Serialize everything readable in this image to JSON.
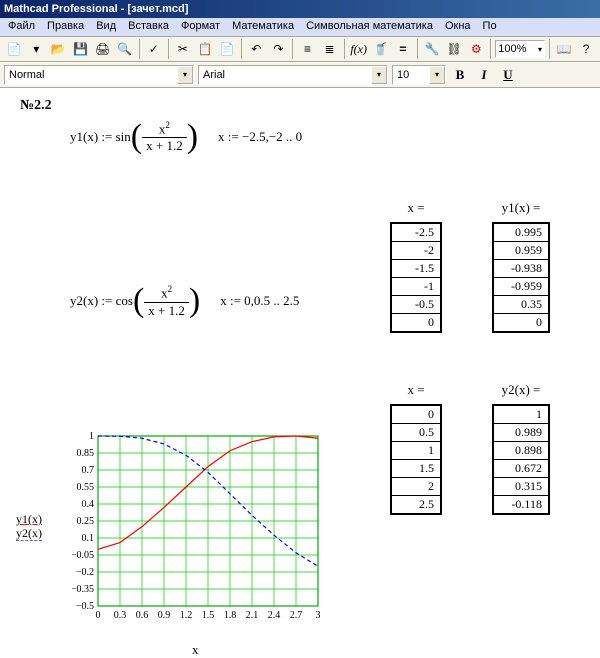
{
  "title": "Mathcad Professional - [зачет.mcd]",
  "menu": [
    "Файл",
    "Правка",
    "Вид",
    "Вставка",
    "Формат",
    "Математика",
    "Символьная математика",
    "Окна",
    "По"
  ],
  "zoom": "100%",
  "style": "Normal",
  "font": "Arial",
  "fontsize": "10",
  "section": "№2.2",
  "eq1": {
    "lhs": "y1(x)",
    "fn": "sin",
    "num": "x",
    "den": "x + 1.2",
    "range": "x := −2.5,−2 .. 0"
  },
  "eq2": {
    "lhs": "y2(x)",
    "fn": "cos",
    "num": "x",
    "den": "x + 1.2",
    "range": "x := 0,0.5 .. 2.5"
  },
  "t1hdr": "x =",
  "t1": [
    "-2.5",
    "-2",
    "-1.5",
    "-1",
    "-0.5",
    "0"
  ],
  "t2hdr": "y1(x) =",
  "t2": [
    "0.995",
    "0.959",
    "-0.938",
    "-0.959",
    "0.35",
    "0"
  ],
  "t3hdr": "x =",
  "t3": [
    "0",
    "0.5",
    "1",
    "1.5",
    "2",
    "2.5"
  ],
  "t4hdr": "y2(x) =",
  "t4": [
    "1",
    "0.989",
    "0.898",
    "0.672",
    "0.315",
    "-0.118"
  ],
  "ylabels": [
    "1",
    "0.85",
    "0.7",
    "0.55",
    "0.4",
    "0.25",
    "0.1",
    "−0.05",
    "−0.2",
    "−0.35",
    "−0.5"
  ],
  "xlabels": [
    "0",
    "0.3",
    "0.6",
    "0.9",
    "1.2",
    "1.5",
    "1.8",
    "2.1",
    "2.4",
    "2.7",
    "3"
  ],
  "plotylab1": "y1(x)",
  "plotylab2": "y2(x)",
  "plotxlab": "x",
  "chart_data": {
    "type": "line",
    "xlabel": "x",
    "series": [
      {
        "name": "y1(x)",
        "color": "red",
        "x": [
          0,
          0.3,
          0.6,
          0.9,
          1.2,
          1.5,
          1.8,
          2.1,
          2.4,
          2.7,
          3
        ],
        "y": [
          0,
          0.06,
          0.2,
          0.37,
          0.55,
          0.73,
          0.87,
          0.95,
          0.992,
          1.0,
          0.98
        ]
      },
      {
        "name": "y2(x)",
        "color": "blue",
        "style": "dashed",
        "x": [
          0,
          0.3,
          0.6,
          0.9,
          1.2,
          1.5,
          1.8,
          2.1,
          2.4,
          2.7,
          3
        ],
        "y": [
          1,
          0.998,
          0.98,
          0.93,
          0.83,
          0.68,
          0.49,
          0.3,
          0.125,
          -0.03,
          -0.15
        ]
      }
    ],
    "xlim": [
      0,
      3
    ],
    "ylim": [
      -0.5,
      1
    ]
  }
}
